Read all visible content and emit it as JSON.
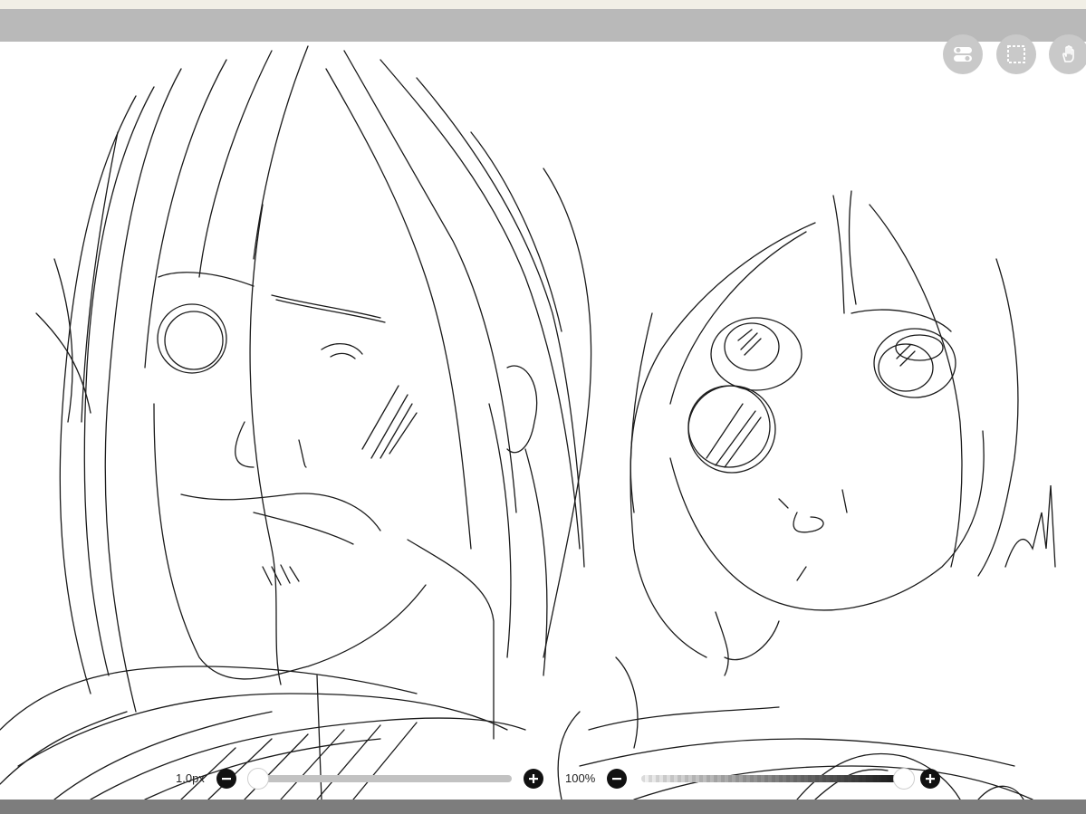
{
  "toolbar": {
    "tools": [
      {
        "name": "toggle-icon",
        "active": false
      },
      {
        "name": "selection-icon",
        "active": false
      },
      {
        "name": "hand-icon",
        "active": false
      }
    ]
  },
  "brush_size": {
    "label": "1.0px",
    "minus_icon": "minus-icon",
    "plus_icon": "plus-icon",
    "level": 0.0
  },
  "opacity": {
    "label": "100%",
    "minus_icon": "minus-icon",
    "plus_icon": "plus-icon",
    "level": 1.0
  },
  "colors": {
    "top_bar": "#b9b9b9",
    "bottom_bar": "#7d7d7d",
    "button_bg": "#c9c9c9",
    "stroke": "#1a1a1a"
  }
}
